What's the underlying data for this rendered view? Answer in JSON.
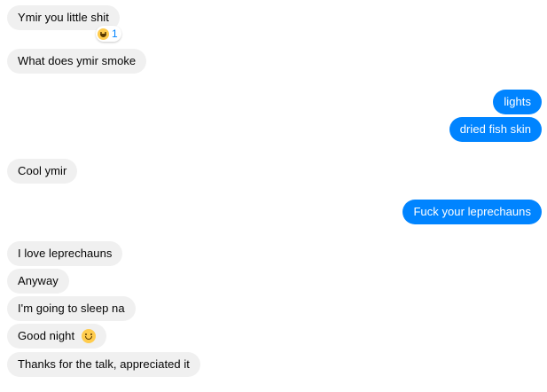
{
  "conversation": {
    "messages": [
      {
        "text": "Ymir you little shit",
        "from": "them"
      },
      {
        "text": "What does ymir smoke",
        "from": "them"
      },
      {
        "text": "lights",
        "from": "me"
      },
      {
        "text": "dried fish skin",
        "from": "me"
      },
      {
        "text": "Cool ymir",
        "from": "them"
      },
      {
        "text": "Fuck your leprechauns",
        "from": "me"
      },
      {
        "text": "I love leprechauns",
        "from": "them"
      },
      {
        "text": "Anyway",
        "from": "them"
      },
      {
        "text": "I'm going to sleep na",
        "from": "them"
      },
      {
        "text": "Good night",
        "from": "them",
        "emoji": "slightly-smiling-face-icon"
      },
      {
        "text": "Thanks for the talk, appreciated it",
        "from": "them"
      }
    ],
    "reaction": {
      "emoji": "laughing-face-icon",
      "count": "1"
    }
  },
  "colors": {
    "incoming_bubble": "#f0f0f0",
    "outgoing_bubble": "#0084ff",
    "reaction_count": "#0084ff"
  }
}
